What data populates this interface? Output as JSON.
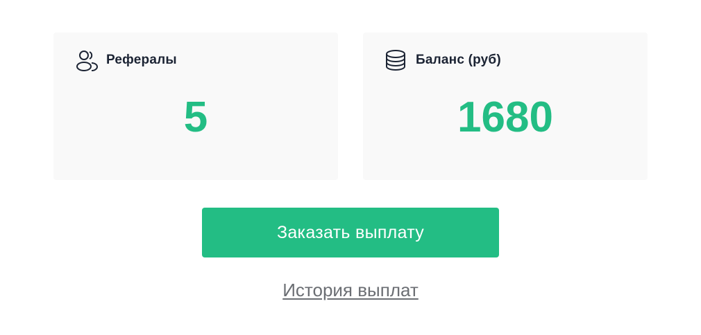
{
  "cards": {
    "referrals": {
      "icon": "users-icon",
      "title": "Рефералы",
      "value": "5"
    },
    "balance": {
      "icon": "coins-icon",
      "title": "Баланс (руб)",
      "value": "1680"
    }
  },
  "actions": {
    "payout_button_label": "Заказать выплату",
    "history_link_label": "История выплат"
  },
  "colors": {
    "accent": "#23bd84",
    "card_bg": "#f9f9f9",
    "title_text": "#1b2333",
    "link_text": "#6b6e73"
  }
}
